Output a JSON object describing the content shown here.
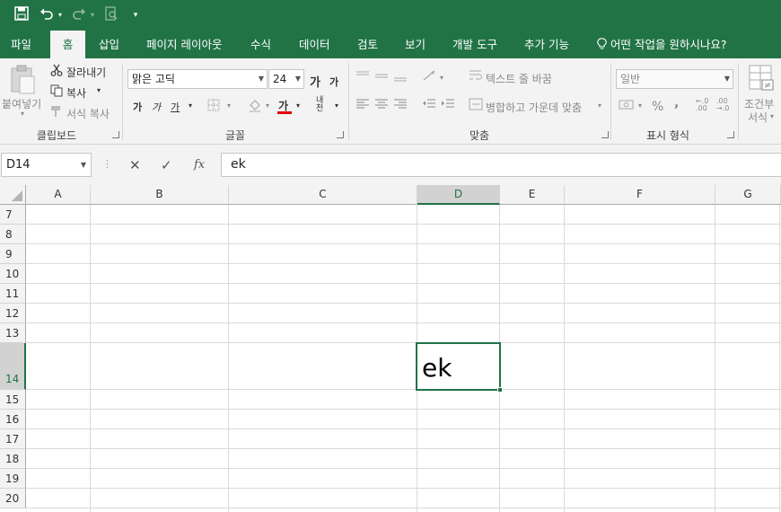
{
  "qat": {
    "save_icon": "save-icon",
    "undo_icon": "undo-icon",
    "redo_icon": "redo-icon",
    "preview_icon": "print-preview-icon",
    "customize_icon": "customize-qat-icon"
  },
  "tabs": [
    "파일",
    "홈",
    "삽입",
    "페이지 레이아웃",
    "수식",
    "데이터",
    "검토",
    "보기",
    "개발 도구",
    "추가 기능"
  ],
  "tell_me": "어떤 작업을 원하시나요?",
  "ribbon": {
    "clipboard": {
      "paste": "붙여넣기",
      "cut": "잘라내기",
      "copy": "복사",
      "format_painter": "서식 복사",
      "label": "클립보드"
    },
    "font": {
      "name": "맑은 고딕",
      "size": "24",
      "grow": "가",
      "shrink": "가",
      "bold": "가",
      "italic": "가",
      "underline": "가",
      "font_color": "가",
      "phonetic": "내천",
      "label": "글꼴"
    },
    "alignment": {
      "wrap_text": "텍스트 줄 바꿈",
      "merge_center": "병합하고 가운데 맞춤",
      "label": "맞춤"
    },
    "number": {
      "format": "일반",
      "percent": "%",
      "comma": ",",
      "inc_decimal": "←.0 .00",
      "dec_decimal": ".00 →.0",
      "label": "표시 형식"
    },
    "styles": {
      "conditional_line1": "조건부",
      "conditional_line2": "서식"
    }
  },
  "formula_bar": {
    "name_box": "D14",
    "cancel": "✕",
    "enter": "✓",
    "fx": "fx",
    "value": "ek"
  },
  "columns": [
    "A",
    "B",
    "C",
    "D",
    "E",
    "F",
    "G"
  ],
  "rows": [
    "7",
    "8",
    "9",
    "10",
    "11",
    "12",
    "13",
    "14",
    "15",
    "16",
    "17",
    "18",
    "19",
    "20"
  ],
  "selected_cell": {
    "ref": "D14",
    "value": "ek"
  },
  "colors": {
    "accent": "#217346",
    "ribbon_bg": "#f3f3f3",
    "gridline": "#dadada"
  }
}
